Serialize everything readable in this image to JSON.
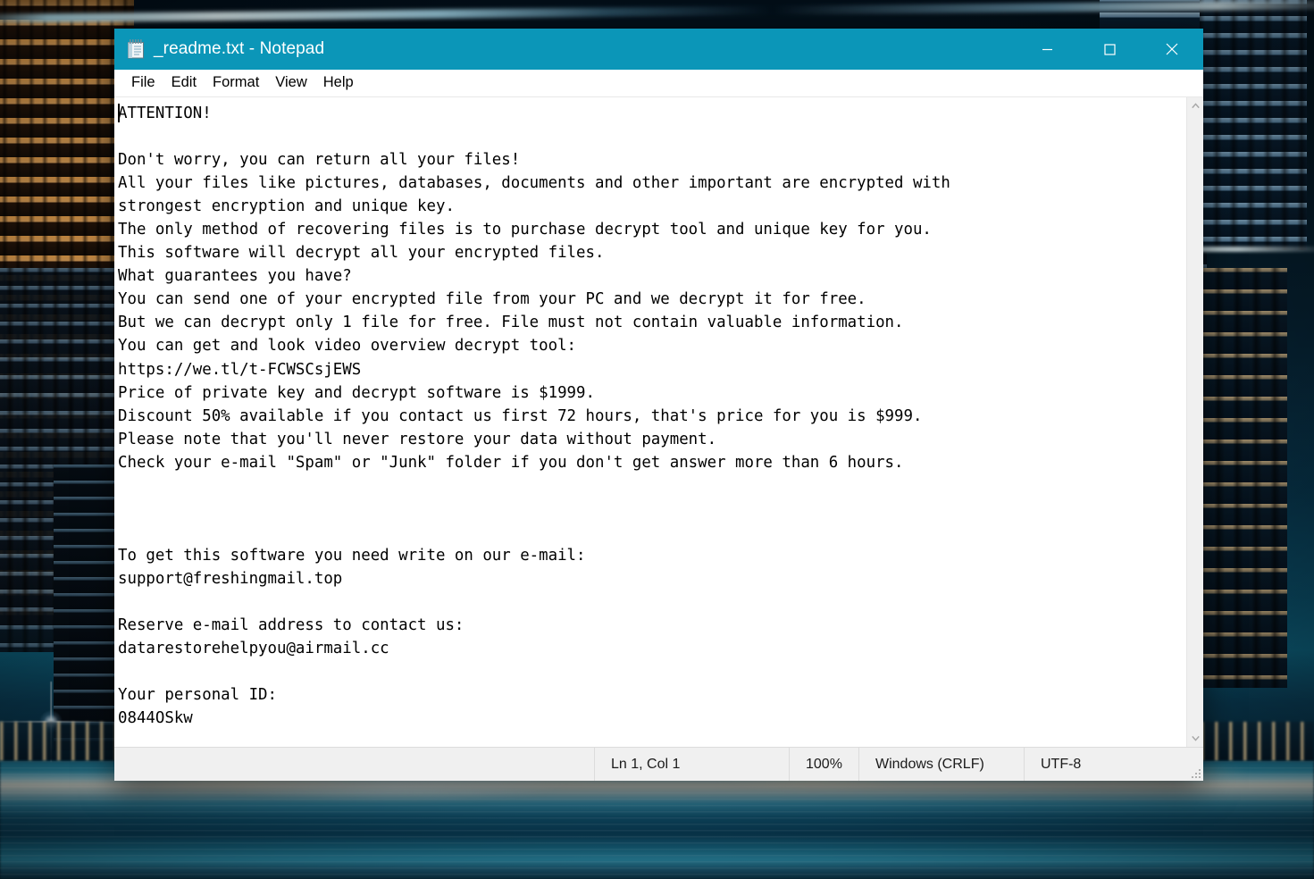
{
  "window": {
    "title": "_readme.txt - Notepad",
    "icon": "notepad-icon",
    "accent_color": "#0b96b8",
    "controls": {
      "minimize": "Minimize",
      "maximize": "Maximize",
      "close": "Close"
    }
  },
  "menubar": {
    "items": [
      {
        "label": "File"
      },
      {
        "label": "Edit"
      },
      {
        "label": "Format"
      },
      {
        "label": "View"
      },
      {
        "label": "Help"
      }
    ]
  },
  "document": {
    "filename": "_readme.txt",
    "content": "ATTENTION!\n\nDon't worry, you can return all your files!\nAll your files like pictures, databases, documents and other important are encrypted with\nstrongest encryption and unique key.\nThe only method of recovering files is to purchase decrypt tool and unique key for you.\nThis software will decrypt all your encrypted files.\nWhat guarantees you have?\nYou can send one of your encrypted file from your PC and we decrypt it for free.\nBut we can decrypt only 1 file for free. File must not contain valuable information.\nYou can get and look video overview decrypt tool:\nhttps://we.tl/t-FCWSCsjEWS\nPrice of private key and decrypt software is $1999.\nDiscount 50% available if you contact us first 72 hours, that's price for you is $999.\nPlease note that you'll never restore your data without payment.\nCheck your e-mail \"Spam\" or \"Junk\" folder if you don't get answer more than 6 hours.\n\n\n\nTo get this software you need write on our e-mail:\nsupport@freshingmail.top\n\nReserve e-mail address to contact us:\ndatarestorehelpyou@airmail.cc\n\nYour personal ID:\n0844OSkw",
    "details": {
      "heading": "ATTENTION!",
      "url": "https://we.tl/t-FCWSCsjEWS",
      "price_full": "$1999",
      "price_discount": "$999",
      "discount_percent": "50%",
      "discount_window_hours": "72",
      "answer_delay_hours": "6",
      "free_files": "1",
      "primary_email": "support@freshingmail.top",
      "reserve_email": "datarestorehelpyou@airmail.cc",
      "personal_id": "0844OSkw"
    }
  },
  "scrollbar": {
    "up_arrow": "scroll-up",
    "down_arrow": "scroll-down"
  },
  "statusbar": {
    "cursor_position": "Ln 1, Col 1",
    "zoom": "100%",
    "line_ending": "Windows (CRLF)",
    "encoding": "UTF-8"
  }
}
